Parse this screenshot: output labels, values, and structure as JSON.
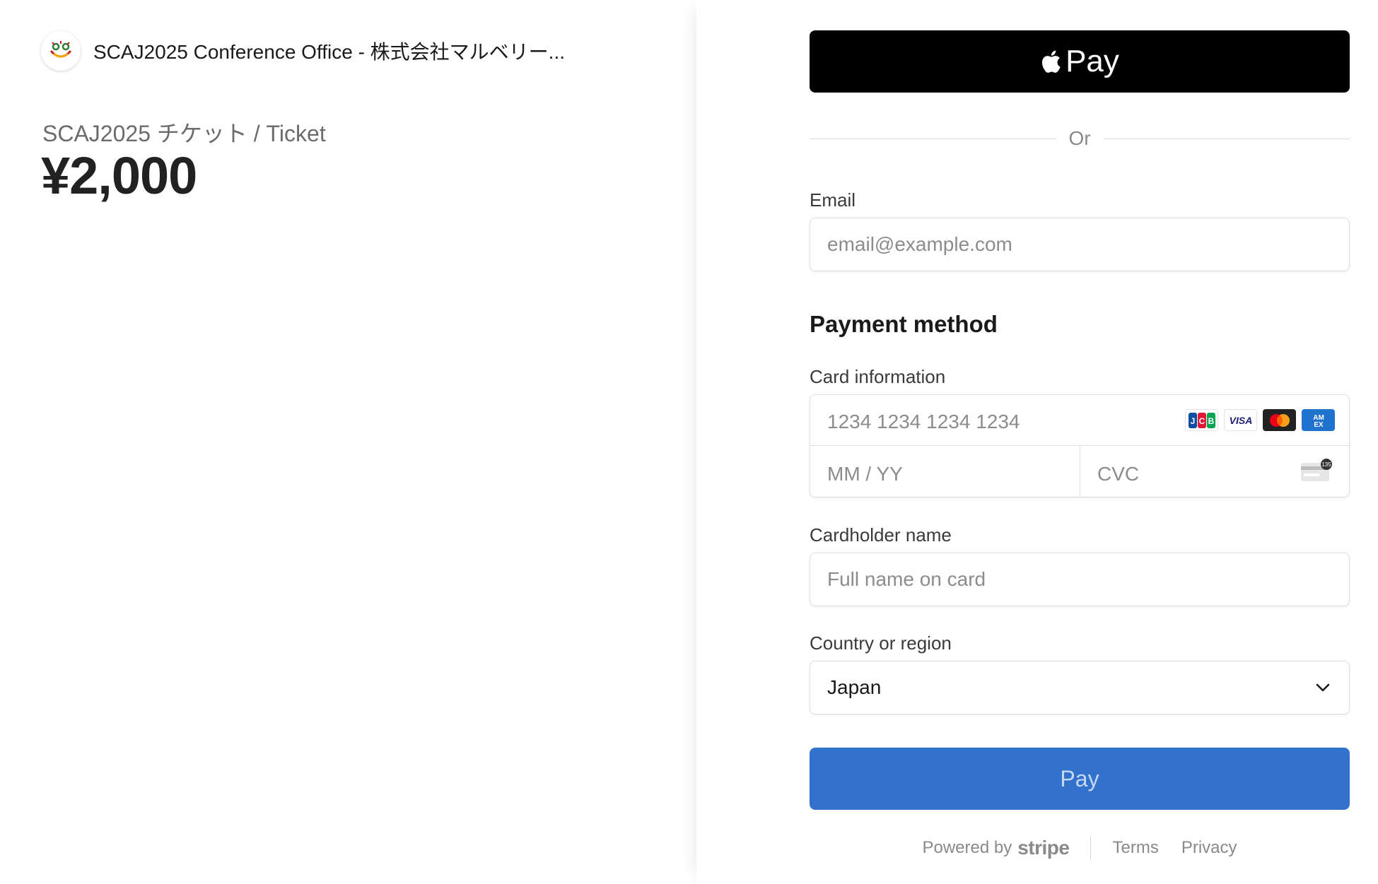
{
  "merchant": {
    "name": "SCAJ2025 Conference Office - 株式会社マルベリー..."
  },
  "product": {
    "name": "SCAJ2025 チケット / Ticket",
    "price": "¥2,000"
  },
  "apple_pay": {
    "label": "Pay"
  },
  "divider": {
    "text": "Or"
  },
  "email": {
    "label": "Email",
    "placeholder": "email@example.com",
    "value": ""
  },
  "payment_method": {
    "heading": "Payment method",
    "card_label": "Card information",
    "card_number_placeholder": "1234 1234 1234 1234",
    "expiry_placeholder": "MM / YY",
    "cvc_placeholder": "CVC",
    "cvc_hint": "135",
    "brands": [
      "JCB",
      "VISA",
      "Mastercard",
      "AMEX"
    ]
  },
  "cardholder": {
    "label": "Cardholder name",
    "placeholder": "Full name on card",
    "value": ""
  },
  "country": {
    "label": "Country or region",
    "selected": "Japan"
  },
  "pay_button": {
    "label": "Pay"
  },
  "footer": {
    "powered_by": "Powered by",
    "stripe": "stripe",
    "terms": "Terms",
    "privacy": "Privacy"
  },
  "colors": {
    "pay_button_bg": "#3372cc",
    "apple_pay_bg": "#000000",
    "left_panel_bg": "#ffffff"
  }
}
